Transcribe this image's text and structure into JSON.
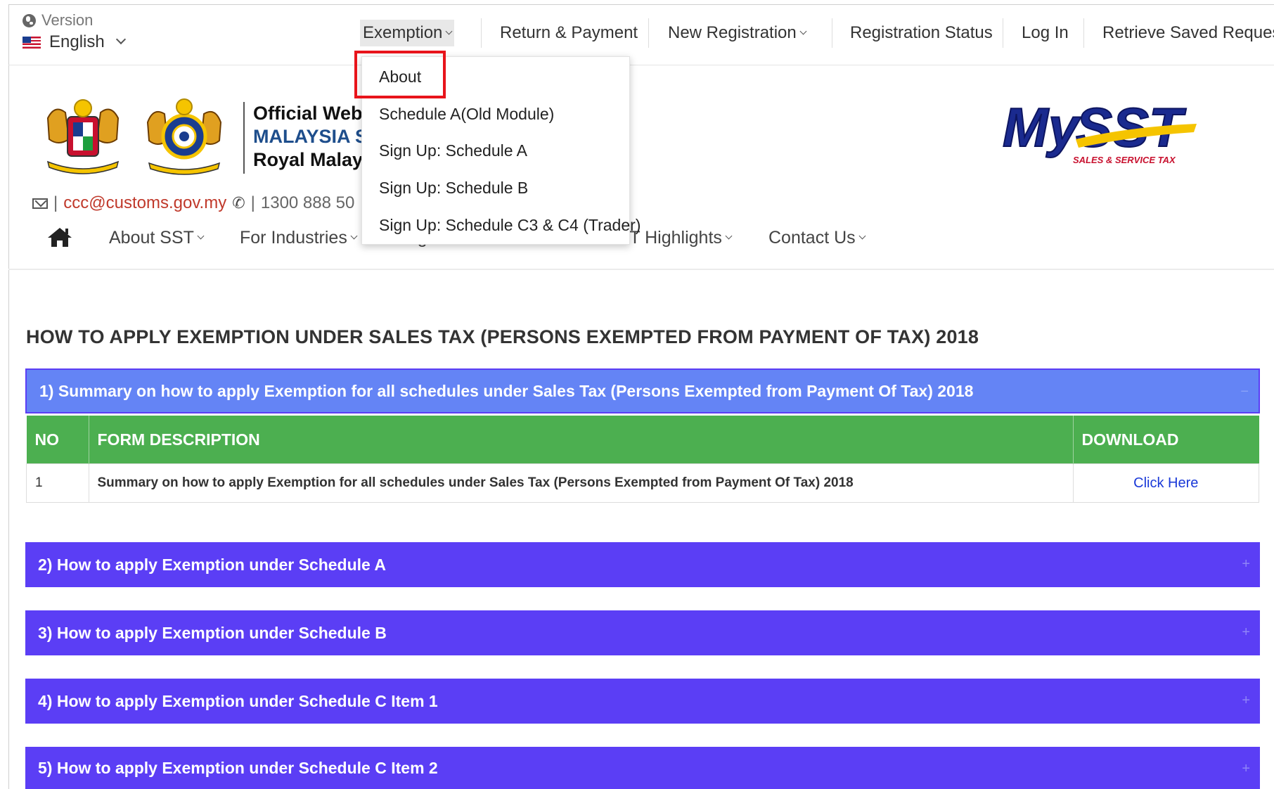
{
  "top_bar": {
    "version_label": "Version",
    "language": "English",
    "nav": [
      {
        "label": "Exemption"
      },
      {
        "label": "Return & Payment"
      },
      {
        "label": "New Registration"
      },
      {
        "label": "Registration Status"
      },
      {
        "label": "Log In"
      },
      {
        "label": "Retrieve Saved Request"
      }
    ]
  },
  "dropdown": {
    "items": [
      {
        "label": "About"
      },
      {
        "label": "Schedule A(Old Module)"
      },
      {
        "label": "Sign Up: Schedule A"
      },
      {
        "label": "Sign Up: Schedule B"
      },
      {
        "label": "Sign Up: Schedule C3 & C4 (Trader)"
      }
    ]
  },
  "header": {
    "official_line1": "Official Web",
    "official_line2": "MALAYSIA S",
    "official_line3": "Royal Malay",
    "email": "ccc@customs.gov.my",
    "phone": "1300 888 50",
    "contact_sep": "|"
  },
  "main_nav": [
    {
      "label": "About SST"
    },
    {
      "label": "For Industries"
    },
    {
      "label": "Legislation & Guides"
    },
    {
      "label": "SST Highlights"
    },
    {
      "label": "Contact Us"
    }
  ],
  "content": {
    "heading": "HOW TO APPLY EXEMPTION UNDER SALES TAX (PERSONS EXEMPTED FROM PAYMENT OF TAX) 2018",
    "panels": [
      {
        "title": "1) Summary on how to apply Exemption for all schedules under Sales Tax (Persons Exempted from Payment Of Tax) 2018",
        "toggle": "−"
      },
      {
        "title": "2) How to apply Exemption under Schedule A",
        "toggle": "+"
      },
      {
        "title": "3) How to apply Exemption under Schedule B",
        "toggle": "+"
      },
      {
        "title": "4) How to apply Exemption under Schedule C Item 1",
        "toggle": "+"
      },
      {
        "title": "5) How to apply Exemption under Schedule C Item 2",
        "toggle": "+"
      }
    ],
    "table": {
      "headers": {
        "no": "NO",
        "desc": "FORM DESCRIPTION",
        "download": "DOWNLOAD"
      },
      "rows": [
        {
          "no": "1",
          "desc": "Summary on how to apply Exemption for all schedules under Sales Tax (Persons Exempted from Payment Of Tax) 2018",
          "download": "Click Here"
        }
      ]
    }
  },
  "colors": {
    "panel": "#5b3ef5",
    "panel_open": "#6484f5",
    "table_header": "#4caf50",
    "highlight": "#e8141b",
    "link": "#1a39d8"
  }
}
